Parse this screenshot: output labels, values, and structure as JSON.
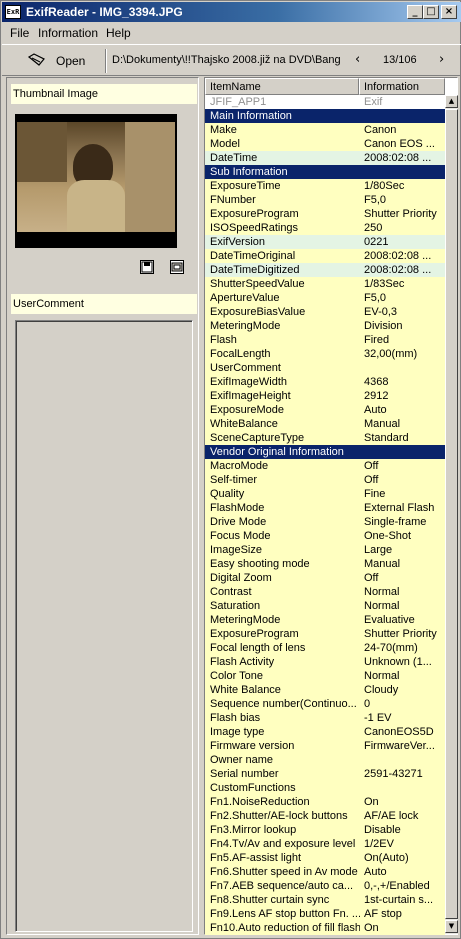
{
  "window": {
    "app_icon_text": "ExR",
    "title": "ExifReader - IMG_3394.JPG",
    "minimize": "_",
    "maximize": "□",
    "close": "×"
  },
  "menu": [
    "File",
    "Information",
    "Help"
  ],
  "toolbar": {
    "open_icon": "open-folder-icon",
    "open_label": "Open",
    "path": "D:\\Dokumenty\\!!Thajsko 2008.již na DVD\\Bang",
    "prev": "‹",
    "counter": "13/106",
    "next": "›"
  },
  "left": {
    "thumbnail_label": "Thumbnail Image",
    "save_icon": "save-icon",
    "view_icon": "view-icon",
    "comment_label": "UserComment"
  },
  "table": {
    "headers": [
      "ItemName",
      "Information"
    ],
    "rows": [
      {
        "name": "JFIF_APP1",
        "value": "Exif",
        "style": "gray"
      },
      {
        "name": "Main Information",
        "value": "",
        "style": "section"
      },
      {
        "name": "Make",
        "value": "Canon",
        "style": "yellow"
      },
      {
        "name": "Model",
        "value": "Canon EOS ...",
        "style": "yellow"
      },
      {
        "name": "DateTime",
        "value": "2008:02:08 ...",
        "style": "green"
      },
      {
        "name": "Sub Information",
        "value": "",
        "style": "section"
      },
      {
        "name": "ExposureTime",
        "value": "1/80Sec",
        "style": "yellow"
      },
      {
        "name": "FNumber",
        "value": "F5,0",
        "style": "yellow"
      },
      {
        "name": "ExposureProgram",
        "value": "Shutter Priority",
        "style": "yellow"
      },
      {
        "name": "ISOSpeedRatings",
        "value": "250",
        "style": "yellow"
      },
      {
        "name": "ExifVersion",
        "value": "0221",
        "style": "green"
      },
      {
        "name": "DateTimeOriginal",
        "value": "2008:02:08 ...",
        "style": "yellow"
      },
      {
        "name": "DateTimeDigitized",
        "value": "2008:02:08 ...",
        "style": "green"
      },
      {
        "name": "ShutterSpeedValue",
        "value": "1/83Sec",
        "style": "yellow"
      },
      {
        "name": "ApertureValue",
        "value": "F5,0",
        "style": "yellow"
      },
      {
        "name": "ExposureBiasValue",
        "value": "EV-0,3",
        "style": "yellow"
      },
      {
        "name": "MeteringMode",
        "value": "Division",
        "style": "yellow"
      },
      {
        "name": "Flash",
        "value": "Fired",
        "style": "yellow"
      },
      {
        "name": "FocalLength",
        "value": "32,00(mm)",
        "style": "yellow"
      },
      {
        "name": "UserComment",
        "value": "",
        "style": "yellow"
      },
      {
        "name": "ExifImageWidth",
        "value": "4368",
        "style": "yellow"
      },
      {
        "name": "ExifImageHeight",
        "value": "2912",
        "style": "yellow"
      },
      {
        "name": "ExposureMode",
        "value": "Auto",
        "style": "yellow"
      },
      {
        "name": "WhiteBalance",
        "value": "Manual",
        "style": "yellow"
      },
      {
        "name": "SceneCaptureType",
        "value": "Standard",
        "style": "yellow"
      },
      {
        "name": "Vendor Original Information",
        "value": "",
        "style": "section"
      },
      {
        "name": "MacroMode",
        "value": "Off",
        "style": "yellow"
      },
      {
        "name": "Self-timer",
        "value": "Off",
        "style": "yellow"
      },
      {
        "name": "Quality",
        "value": "Fine",
        "style": "yellow"
      },
      {
        "name": "FlashMode",
        "value": "External Flash",
        "style": "yellow"
      },
      {
        "name": "Drive Mode",
        "value": "Single-frame",
        "style": "yellow"
      },
      {
        "name": "Focus Mode",
        "value": "One-Shot",
        "style": "yellow"
      },
      {
        "name": "ImageSize",
        "value": "Large",
        "style": "yellow"
      },
      {
        "name": "Easy shooting mode",
        "value": "Manual",
        "style": "yellow"
      },
      {
        "name": "Digital Zoom",
        "value": "Off",
        "style": "yellow"
      },
      {
        "name": "Contrast",
        "value": "Normal",
        "style": "yellow"
      },
      {
        "name": "Saturation",
        "value": "Normal",
        "style": "yellow"
      },
      {
        "name": "MeteringMode",
        "value": "Evaluative",
        "style": "yellow"
      },
      {
        "name": "ExposureProgram",
        "value": "Shutter Priority",
        "style": "yellow"
      },
      {
        "name": "Focal length of lens",
        "value": "24-70(mm)",
        "style": "yellow"
      },
      {
        "name": "Flash Activity",
        "value": "Unknown (1...",
        "style": "yellow"
      },
      {
        "name": "Color Tone",
        "value": "Normal",
        "style": "yellow"
      },
      {
        "name": "White Balance",
        "value": "Cloudy",
        "style": "yellow"
      },
      {
        "name": "Sequence number(Continuo...",
        "value": "0",
        "style": "yellow"
      },
      {
        "name": "Flash bias",
        "value": "-1 EV",
        "style": "yellow"
      },
      {
        "name": "Image type",
        "value": "CanonEOS5D",
        "style": "yellow"
      },
      {
        "name": "Firmware version",
        "value": "FirmwareVer...",
        "style": "yellow"
      },
      {
        "name": "Owner name",
        "value": "",
        "style": "yellow"
      },
      {
        "name": "Serial number",
        "value": "2591-43271",
        "style": "yellow"
      },
      {
        "name": "CustomFunctions",
        "value": "",
        "style": "yellow"
      },
      {
        "name": "Fn1.NoiseReduction",
        "value": "On",
        "style": "yellow"
      },
      {
        "name": "Fn2.Shutter/AE-lock buttons",
        "value": "AF/AE lock",
        "style": "yellow"
      },
      {
        "name": "Fn3.Mirror lookup",
        "value": "Disable",
        "style": "yellow"
      },
      {
        "name": "Fn4.Tv/Av and exposure level",
        "value": "1/2EV",
        "style": "yellow"
      },
      {
        "name": "Fn5.AF-assist light",
        "value": "On(Auto)",
        "style": "yellow"
      },
      {
        "name": "Fn6.Shutter speed in Av mode",
        "value": "Auto",
        "style": "yellow"
      },
      {
        "name": "Fn7.AEB sequence/auto ca...",
        "value": "0,-,+/Enabled",
        "style": "yellow"
      },
      {
        "name": "Fn8.Shutter curtain sync",
        "value": "1st-curtain s...",
        "style": "yellow"
      },
      {
        "name": "Fn9.Lens AF stop button Fn. ...",
        "value": "AF stop",
        "style": "yellow"
      },
      {
        "name": "Fn10.Auto reduction of fill flash",
        "value": "On",
        "style": "yellow"
      }
    ]
  },
  "scrollbar": {
    "up": "▲",
    "down": "▼"
  }
}
